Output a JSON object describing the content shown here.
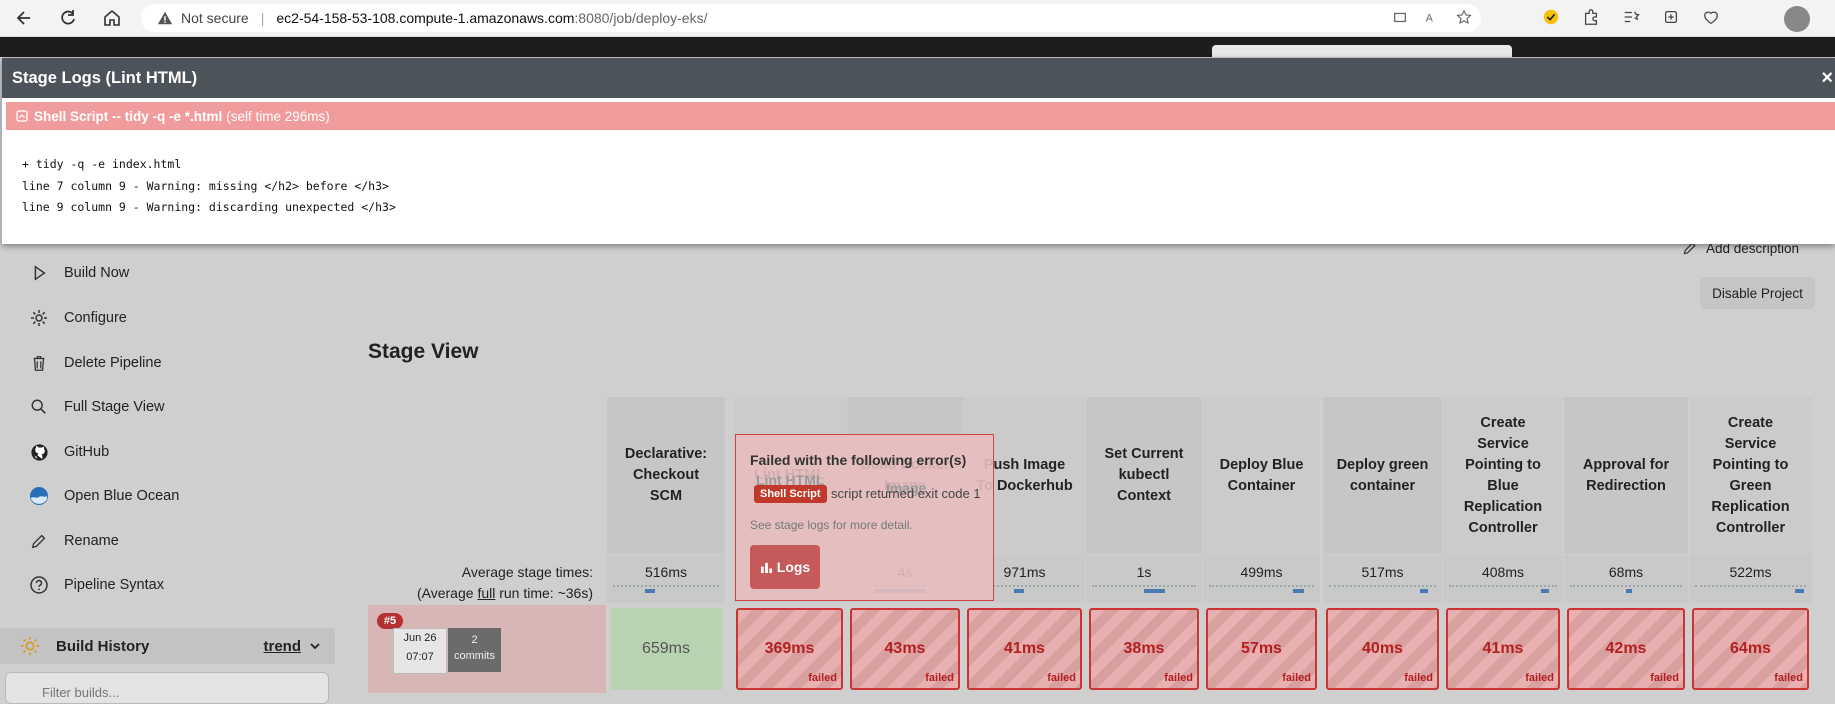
{
  "browser": {
    "not_secure": "Not secure",
    "host": "ec2-54-158-53-108.compute-1.amazonaws.com",
    "path": ":8080/job/deploy-eks/"
  },
  "sidebar": {
    "items": [
      {
        "label": "Build Now",
        "icon": "play-icon"
      },
      {
        "label": "Configure",
        "icon": "gear-icon"
      },
      {
        "label": "Delete Pipeline",
        "icon": "trash-icon"
      },
      {
        "label": "Full Stage View",
        "icon": "search-icon"
      },
      {
        "label": "GitHub",
        "icon": "github-icon"
      },
      {
        "label": "Open Blue Ocean",
        "icon": "blue-ocean-icon"
      },
      {
        "label": "Rename",
        "icon": "pencil-icon"
      },
      {
        "label": "Pipeline Syntax",
        "icon": "help-icon"
      }
    ],
    "build_history": "Build History",
    "trend": "trend",
    "filter_placeholder": "Filter builds..."
  },
  "actions": {
    "add_description": "Add description",
    "disable_project": "Disable Project"
  },
  "stage_view": {
    "title": "Stage View",
    "avg_label_1": "Average stage times:",
    "avg_label_2a": "(Average ",
    "avg_label_full": "full",
    "avg_label_2b": " run time: ~36s)",
    "stages": [
      {
        "name": "Declarative: Checkout SCM",
        "avg": "516ms",
        "run": "659ms",
        "status": "success"
      },
      {
        "name": "Lint HTML",
        "avg": "",
        "run": "369ms",
        "status": "failed"
      },
      {
        "name": "Build Docker Image",
        "avg": "4s",
        "run": "43ms",
        "status": "failed"
      },
      {
        "name": "Push Image To Dockerhub",
        "avg": "971ms",
        "run": "41ms",
        "status": "failed"
      },
      {
        "name": "Set Current kubectl Context",
        "avg": "1s",
        "run": "38ms",
        "status": "failed"
      },
      {
        "name": "Deploy Blue Container",
        "avg": "499ms",
        "run": "57ms",
        "status": "failed"
      },
      {
        "name": "Deploy green container",
        "avg": "517ms",
        "run": "40ms",
        "status": "failed"
      },
      {
        "name": "Create Service Pointing to Blue Replication Controller",
        "avg": "408ms",
        "run": "41ms",
        "status": "failed"
      },
      {
        "name": "Approval for Redirection",
        "avg": "68ms",
        "run": "42ms",
        "status": "failed"
      },
      {
        "name": "Create Service Pointing to Green Replication Controller",
        "avg": "522ms",
        "run": "64ms",
        "status": "failed"
      }
    ],
    "failed_label": "failed",
    "build": {
      "number": "#5",
      "date": "Jun 26",
      "time": "07:07",
      "commits_count": "2",
      "commits_label": "commits"
    }
  },
  "popover": {
    "heading": "Failed with the following error(s)",
    "tag": "Shell Script",
    "message": "script returned exit code 1",
    "see": "See stage logs for more detail.",
    "logs_button": "Logs",
    "ghost_stage": "Lint HTML",
    "ghost_image": "Image",
    "ghost_to": "To"
  },
  "modal": {
    "title": "Stage Logs (Lint HTML)",
    "close": "×",
    "step": "Shell Script -- tidy -q -e *.html",
    "self_time": "(self time 296ms)",
    "log_lines": [
      "+ tidy -q -e index.html",
      "line 7 column 9 - Warning: missing </h2> before </h3>",
      "line 9 column 9 - Warning: discarding unexpected </h3>"
    ]
  },
  "colors": {
    "modal_header": "#4d535b",
    "step_error": "#f19c9c",
    "failed_border": "#cc3333",
    "success_cell": "#b9d2b2"
  }
}
